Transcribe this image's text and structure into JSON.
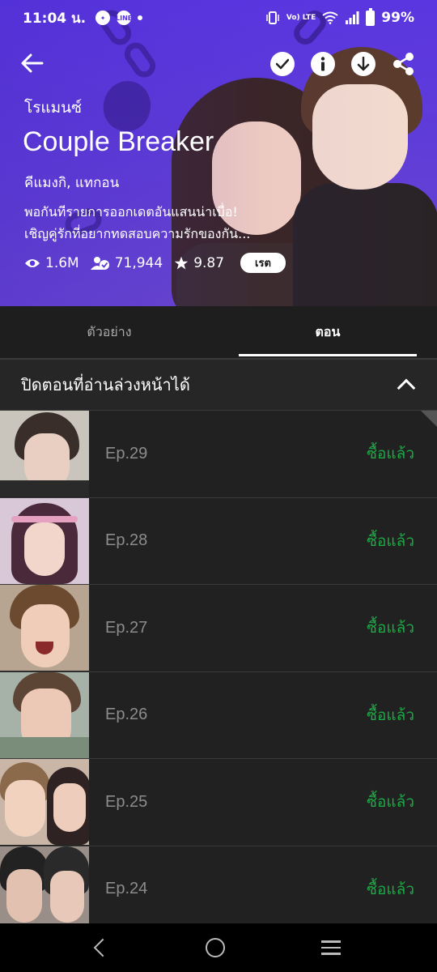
{
  "status_bar": {
    "time": "11:04 น.",
    "network_label": "Vo) LTE",
    "battery": "99%"
  },
  "header": {
    "genre": "โรแมนซ์",
    "title": "Couple Breaker",
    "authors": "คีแมงกิ, แทกอน",
    "description_line1": "พอกันทีรายการออกเดตอันแสนน่าเบื่อ!",
    "description_line2": "เชิญคู่รักที่อยากทดสอบความรักของกัน...",
    "views": "1.6M",
    "subscribers": "71,944",
    "rating": "9.87",
    "rate_label": "เรต"
  },
  "tabs": {
    "preview_label": "ตัวอย่าง",
    "episodes_label": "ตอน",
    "active": "episodes"
  },
  "lock_row": {
    "label": "ปิดตอนที่อ่านล่วงหน้าได้"
  },
  "episodes": [
    {
      "title": "Ep.29",
      "status": "ซื้อแล้ว"
    },
    {
      "title": "Ep.28",
      "status": "ซื้อแล้ว"
    },
    {
      "title": "Ep.27",
      "status": "ซื้อแล้ว"
    },
    {
      "title": "Ep.26",
      "status": "ซื้อแล้ว"
    },
    {
      "title": "Ep.25",
      "status": "ซื้อแล้ว"
    },
    {
      "title": "Ep.24",
      "status": "ซื้อแล้ว"
    }
  ],
  "colors": {
    "accent_purple": "#5a36e0",
    "purchased_green": "#1fa846",
    "dark_bg": "#212121"
  },
  "icons": {
    "back": "arrow-left-icon",
    "check": "check-circle-icon",
    "info": "info-icon",
    "download": "download-icon",
    "share": "share-icon",
    "views": "eye-icon",
    "subscribers": "subscriber-icon",
    "rating": "star-icon"
  }
}
